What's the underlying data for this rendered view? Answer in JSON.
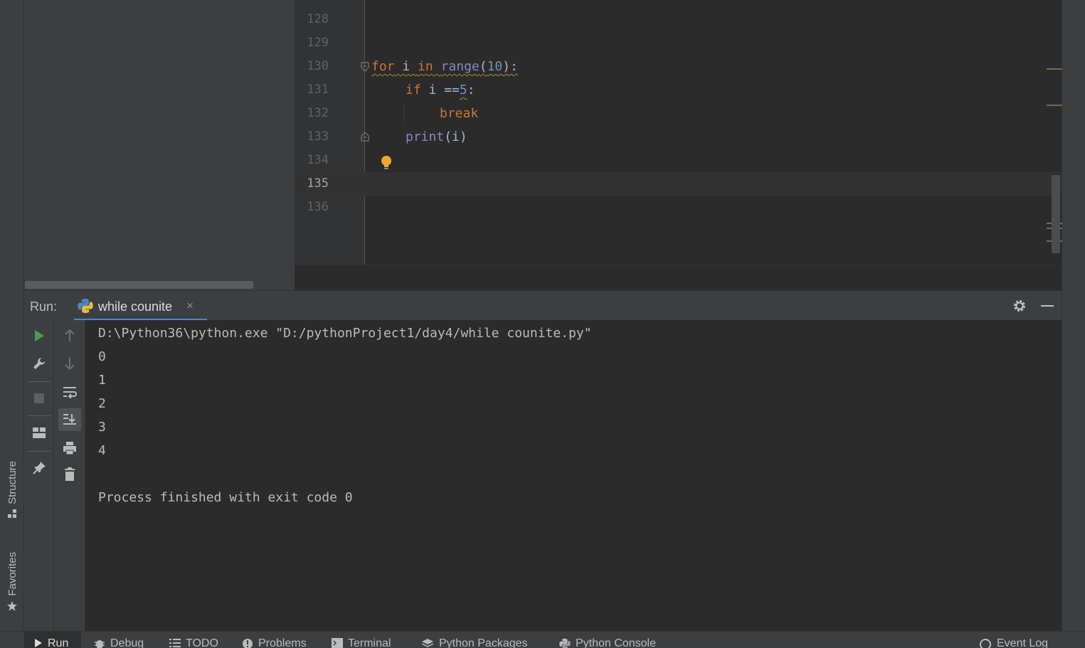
{
  "sidebar": {
    "structure_label": "Structure",
    "favorites_label": "Favorites"
  },
  "editor": {
    "lines": [
      {
        "number": "128"
      },
      {
        "number": "129"
      },
      {
        "number": "130"
      },
      {
        "number": "131"
      },
      {
        "number": "132"
      },
      {
        "number": "133"
      },
      {
        "number": "134"
      },
      {
        "number": "135"
      },
      {
        "number": "136"
      }
    ],
    "code": {
      "for_kw": "for",
      "loop_var": " i ",
      "in_kw": "in",
      "range_fn": "range",
      "range_open": "(",
      "range_arg": "10",
      "range_close": "):",
      "if_kw": "if",
      "if_cond": " i ==",
      "if_num": "5",
      "if_colon": ":",
      "break_kw": "break",
      "print_fn": "print",
      "print_args": "(i)"
    }
  },
  "run": {
    "label": "Run:",
    "tab_name": "while counite",
    "close_glyph": "×"
  },
  "console": {
    "lines": [
      "D:\\Python36\\python.exe \"D:/pythonProject1/day4/while counite.py\"",
      "0",
      "1",
      "2",
      "3",
      "4",
      "",
      "Process finished with exit code 0"
    ]
  },
  "bottom_tabs": {
    "run": "Run",
    "debug": "Debug",
    "todo": "TODO",
    "problems": "Problems",
    "terminal": "Terminal",
    "python_packages": "Python Packages",
    "python_console": "Python Console",
    "event_log": "Event Log"
  },
  "colors": {
    "keyword": "#cc7832",
    "builtin": "#8888c6",
    "number": "#6897bb",
    "accent": "#4a88c7",
    "run_green": "#499c54"
  }
}
